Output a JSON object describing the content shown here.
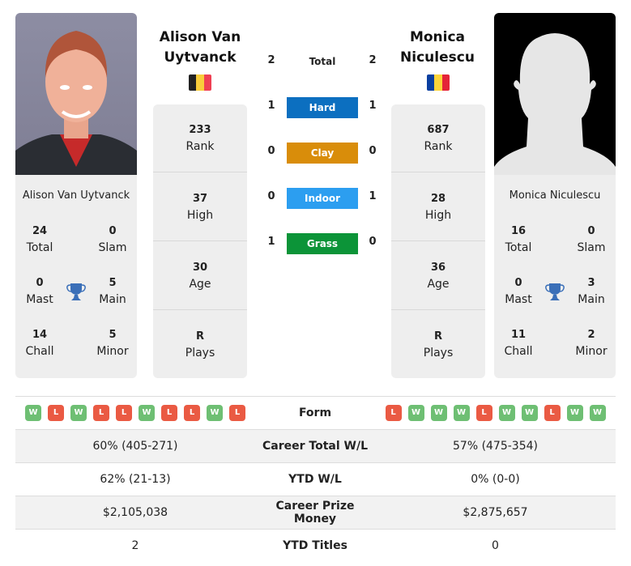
{
  "colors": {
    "hard": "#0c6fc0",
    "clay": "#d98d0a",
    "indoor": "#2c9ef0",
    "grass": "#0c9438",
    "win": "#6ebf73",
    "loss": "#ea5a43",
    "trophy": "#3a6fb8"
  },
  "player1": {
    "name": "Alison Van Uytvanck",
    "head_name_line1": "Alison Van",
    "head_name_line2": "Uytvanck",
    "flag": [
      "#222222",
      "#f9cd3b",
      "#ef4053"
    ],
    "country": "Belgium",
    "titles": {
      "total": "24",
      "total_label": "Total",
      "slam": "0",
      "slam_label": "Slam",
      "mast": "0",
      "mast_label": "Mast",
      "main": "5",
      "main_label": "Main",
      "chall": "14",
      "chall_label": "Chall",
      "minor": "5",
      "minor_label": "Minor"
    },
    "stats": [
      {
        "value": "233",
        "label": "Rank"
      },
      {
        "value": "37",
        "label": "High"
      },
      {
        "value": "30",
        "label": "Age"
      },
      {
        "value": "R",
        "label": "Plays"
      }
    ],
    "form": [
      "W",
      "L",
      "W",
      "L",
      "L",
      "W",
      "L",
      "L",
      "W",
      "L"
    ],
    "career_wl": "60% (405-271)",
    "ytd_wl": "62% (21-13)",
    "prize_money": "$2,105,038",
    "ytd_titles": "2"
  },
  "player2": {
    "name": "Monica Niculescu",
    "head_name_line1": "Monica",
    "head_name_line2": "Niculescu",
    "flag": [
      "#0a3fa0",
      "#fcd43a",
      "#e42438"
    ],
    "country": "Romania",
    "titles": {
      "total": "16",
      "total_label": "Total",
      "slam": "0",
      "slam_label": "Slam",
      "mast": "0",
      "mast_label": "Mast",
      "main": "3",
      "main_label": "Main",
      "chall": "11",
      "chall_label": "Chall",
      "minor": "2",
      "minor_label": "Minor"
    },
    "stats": [
      {
        "value": "687",
        "label": "Rank"
      },
      {
        "value": "28",
        "label": "High"
      },
      {
        "value": "36",
        "label": "Age"
      },
      {
        "value": "R",
        "label": "Plays"
      }
    ],
    "form": [
      "L",
      "W",
      "W",
      "W",
      "L",
      "W",
      "W",
      "L",
      "W",
      "W"
    ],
    "career_wl": "57% (475-354)",
    "ytd_wl": "0% (0-0)",
    "prize_money": "$2,875,657",
    "ytd_titles": "0"
  },
  "h2h": {
    "total_label": "Total",
    "total": {
      "p1": "2",
      "p2": "2"
    },
    "surfaces": [
      {
        "label": "Hard",
        "p1": "1",
        "p2": "1"
      },
      {
        "label": "Clay",
        "p1": "0",
        "p2": "0"
      },
      {
        "label": "Indoor",
        "p1": "0",
        "p2": "1"
      },
      {
        "label": "Grass",
        "p1": "1",
        "p2": "0"
      }
    ]
  },
  "table_labels": {
    "form": "Form",
    "career_wl": "Career Total W/L",
    "ytd_wl": "YTD W/L",
    "prize_money": "Career Prize Money",
    "ytd_titles": "YTD Titles"
  }
}
